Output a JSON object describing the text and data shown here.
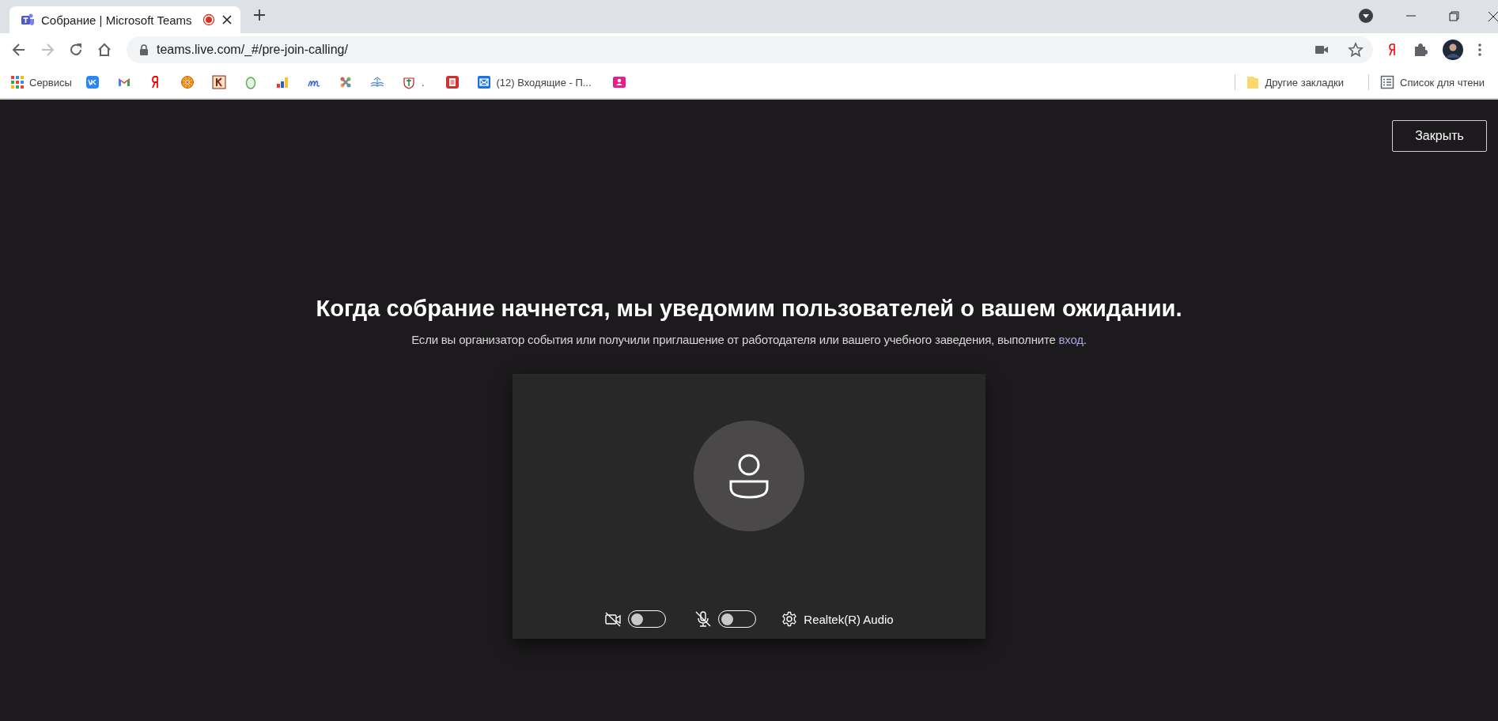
{
  "browser_tab": {
    "title": "Собрание | Microsoft Teams",
    "recording": true,
    "selected": true
  },
  "address_bar": {
    "url": "teams.live.com/_#/pre-join-calling/"
  },
  "bookmarks": [
    {
      "kind": "link",
      "label": "Сервисы"
    },
    {
      "kind": "icon"
    },
    {
      "kind": "icon"
    },
    {
      "kind": "icon"
    },
    {
      "kind": "icon"
    },
    {
      "kind": "icon"
    },
    {
      "kind": "icon"
    },
    {
      "kind": "icon"
    },
    {
      "kind": "icon"
    },
    {
      "kind": "icon"
    },
    {
      "kind": "icon"
    },
    {
      "kind": "link",
      "label": "."
    },
    {
      "kind": "icon"
    },
    {
      "kind": "link",
      "label": "(12) Входящие - П..."
    },
    {
      "kind": "icon"
    }
  ],
  "bookmarks_right": [
    {
      "kind": "folder",
      "label": "Другие закладки"
    },
    {
      "kind": "reading_list",
      "label": "Список для чтени"
    }
  ],
  "page": {
    "close_button": "Закрыть",
    "heading": "Когда собрание начнется, мы уведомим пользователей о вашем ожидании.",
    "subtitle": "Если вы организатор события или получили приглашение от работодателя или вашего учебного заведения, выполните",
    "sign_in_link": "вход",
    "subtitle_end": ".",
    "camera": {
      "on": false
    },
    "microphone": {
      "on": false
    },
    "audio_device": "Realtek(R) Audio"
  }
}
